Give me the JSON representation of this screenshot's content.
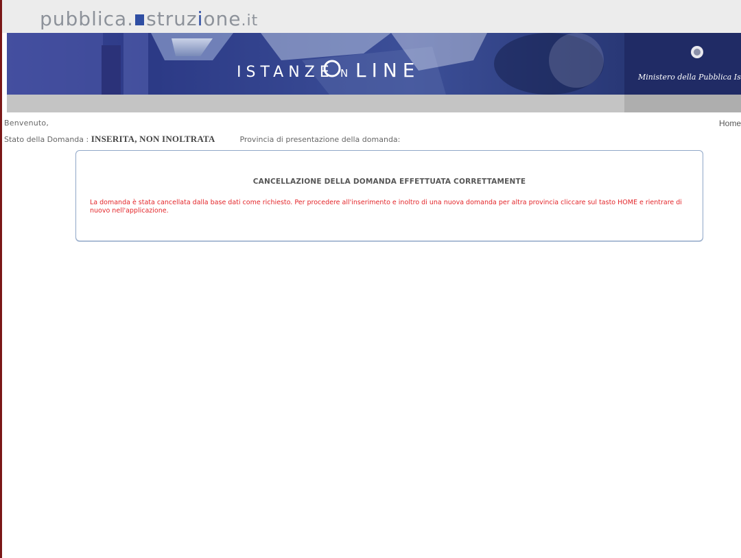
{
  "header": {
    "logo_prefix": "pubblica.",
    "logo_domain_i": "i",
    "logo_domain_rest": "struz",
    "logo_domain_i2": "i",
    "logo_domain_end": "one",
    "logo_tld": ".it",
    "banner_title_left": "ISTANZE",
    "banner_title_right": "LINE",
    "banner_ministry": "Ministero della Pubblica Is"
  },
  "page": {
    "welcome_text": "Benvenuto,",
    "home_link": "Home",
    "status_label": "Stato della Domanda : ",
    "status_value": "INSERITA, NON INOLTRATA",
    "province_label": "Provincia di presentazione della domanda:"
  },
  "panel": {
    "title": "CANCELLAZIONE DELLA DOMANDA EFFETTUATA CORRETTAMENTE",
    "message": "La domanda è stata cancellata dalla base dati come richiesto. Per procedere all'inserimento e inoltro di una nuova domanda per altra provincia cliccare sul tasto HOME e rientrare di nuovo nell'applicazione."
  },
  "colors": {
    "brand_blue": "#2f4ea3",
    "message_red": "#e3262a",
    "panel_border": "#8fa6c7",
    "frame_red": "#7a1717"
  }
}
